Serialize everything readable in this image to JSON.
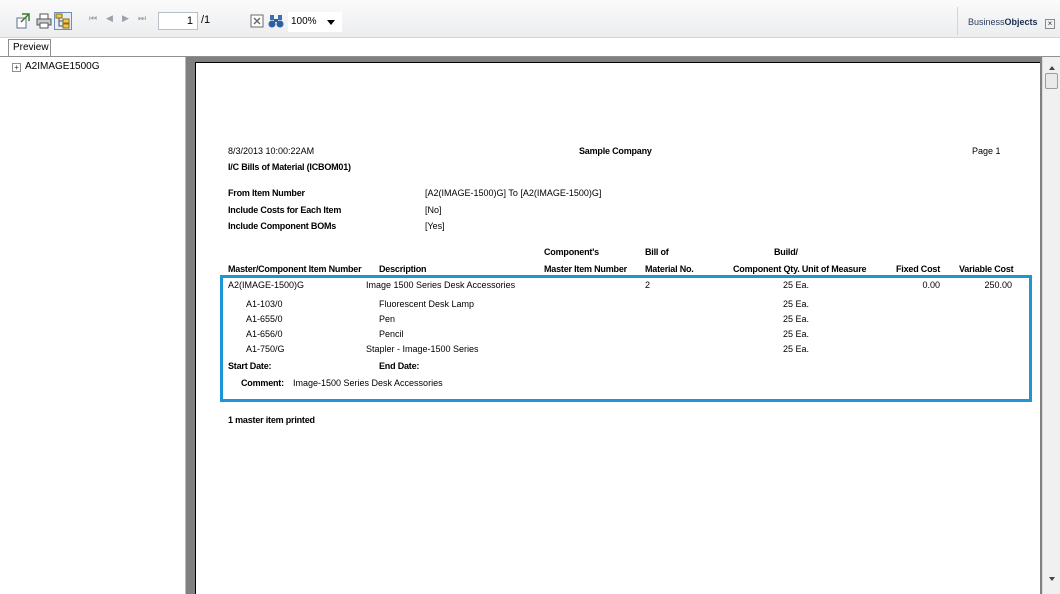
{
  "toolbar": {
    "page_current": "1",
    "page_total": "/1",
    "zoom": "100%",
    "logo_prefix": "Business",
    "logo_bold": "Objects",
    "close": "×"
  },
  "tab": {
    "label": "Preview"
  },
  "tree": {
    "expander": "+",
    "item": "A2IMAGE1500G"
  },
  "report": {
    "datetime": "8/3/2013  10:00:22AM",
    "company": "Sample Company",
    "page": "Page 1",
    "title": "I/C Bills of Material (ICBOM01)",
    "params": [
      {
        "label": "From Item Number",
        "value": "[A2(IMAGE-1500)G]  To  [A2(IMAGE-1500)G]"
      },
      {
        "label": "Include Costs for Each Item",
        "value": "[No]"
      },
      {
        "label": "Include Component BOMs",
        "value": "[Yes]"
      }
    ],
    "headers": {
      "master_component": "Master/Component  Item Number",
      "description": "Description",
      "component_master_1": "Component's",
      "component_master_2": "Master Item Number",
      "bill_of_1": "Bill of",
      "bill_of_2": "Material No.",
      "build_1": "Build/",
      "build_2": "Component Qty. Unit of Measure",
      "fixed_cost": "Fixed Cost",
      "variable_cost": "Variable Cost"
    },
    "master": {
      "item": "A2(IMAGE-1500)G",
      "description": "Image 1500 Series Desk Accessories",
      "bill_no": "2",
      "qty": "25 Ea.",
      "fixed_cost": "0.00",
      "variable_cost": "250.00"
    },
    "components": [
      {
        "item": "A1-103/0",
        "description": "Fluorescent Desk Lamp",
        "qty": "25 Ea."
      },
      {
        "item": "A1-655/0",
        "description": "Pen",
        "qty": "25 Ea."
      },
      {
        "item": "A1-656/0",
        "description": "Pencil",
        "qty": "25 Ea."
      },
      {
        "item": "A1-750/G",
        "description": "Stapler - Image-1500 Series",
        "qty": "25 Ea."
      }
    ],
    "start_date_label": "Start Date:",
    "end_date_label": "End Date:",
    "comment_label": "Comment:",
    "comment_value": "Image-1500 Series Desk Accessories",
    "footer": "1 master item printed"
  },
  "colors": {
    "highlight": "#1e96d4",
    "viewer_bg": "#808080"
  }
}
